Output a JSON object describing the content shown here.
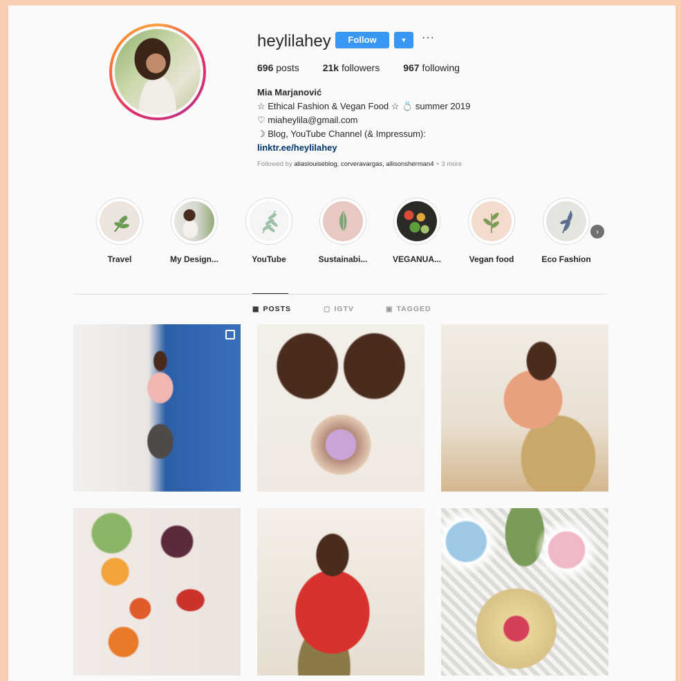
{
  "profile": {
    "username": "heylilahey",
    "follow_label": "Follow",
    "dropdown_icon": "chevron-down-icon",
    "more_icon": "ellipsis-icon",
    "stats": {
      "posts_count": "696",
      "posts_label": "posts",
      "followers_count": "21k",
      "followers_label": "followers",
      "following_count": "967",
      "following_label": "following"
    },
    "bio": {
      "name": "Mia Marjanović",
      "line1": "☆ Ethical Fashion & Vegan Food ☆ 💍 summer 2019",
      "line2": "♡ miaheylila@gmail.com",
      "line3": "☽ Blog, YouTube Channel (& Impressum):",
      "link": "linktr.ee/heylilahey"
    },
    "followed_by": {
      "prefix": "Followed by",
      "names": "aliaslouiseblog, corveravargas, allisonsherman4",
      "more": "+ 3 more"
    }
  },
  "highlights": [
    {
      "label": "Travel"
    },
    {
      "label": "My Design..."
    },
    {
      "label": "YouTube"
    },
    {
      "label": "Sustainabi..."
    },
    {
      "label": "VEGANUA..."
    },
    {
      "label": "Vegan food"
    },
    {
      "label": "Eco Fashion"
    }
  ],
  "tabs": [
    {
      "label": "POSTS",
      "icon": "grid-icon",
      "active": true
    },
    {
      "label": "IGTV",
      "icon": "igtv-icon",
      "active": false
    },
    {
      "label": "TAGGED",
      "icon": "tagged-icon",
      "active": false
    }
  ],
  "colors": {
    "accent": "#3897f0",
    "background": "#fafafa",
    "frame": "#f9cdb0"
  }
}
